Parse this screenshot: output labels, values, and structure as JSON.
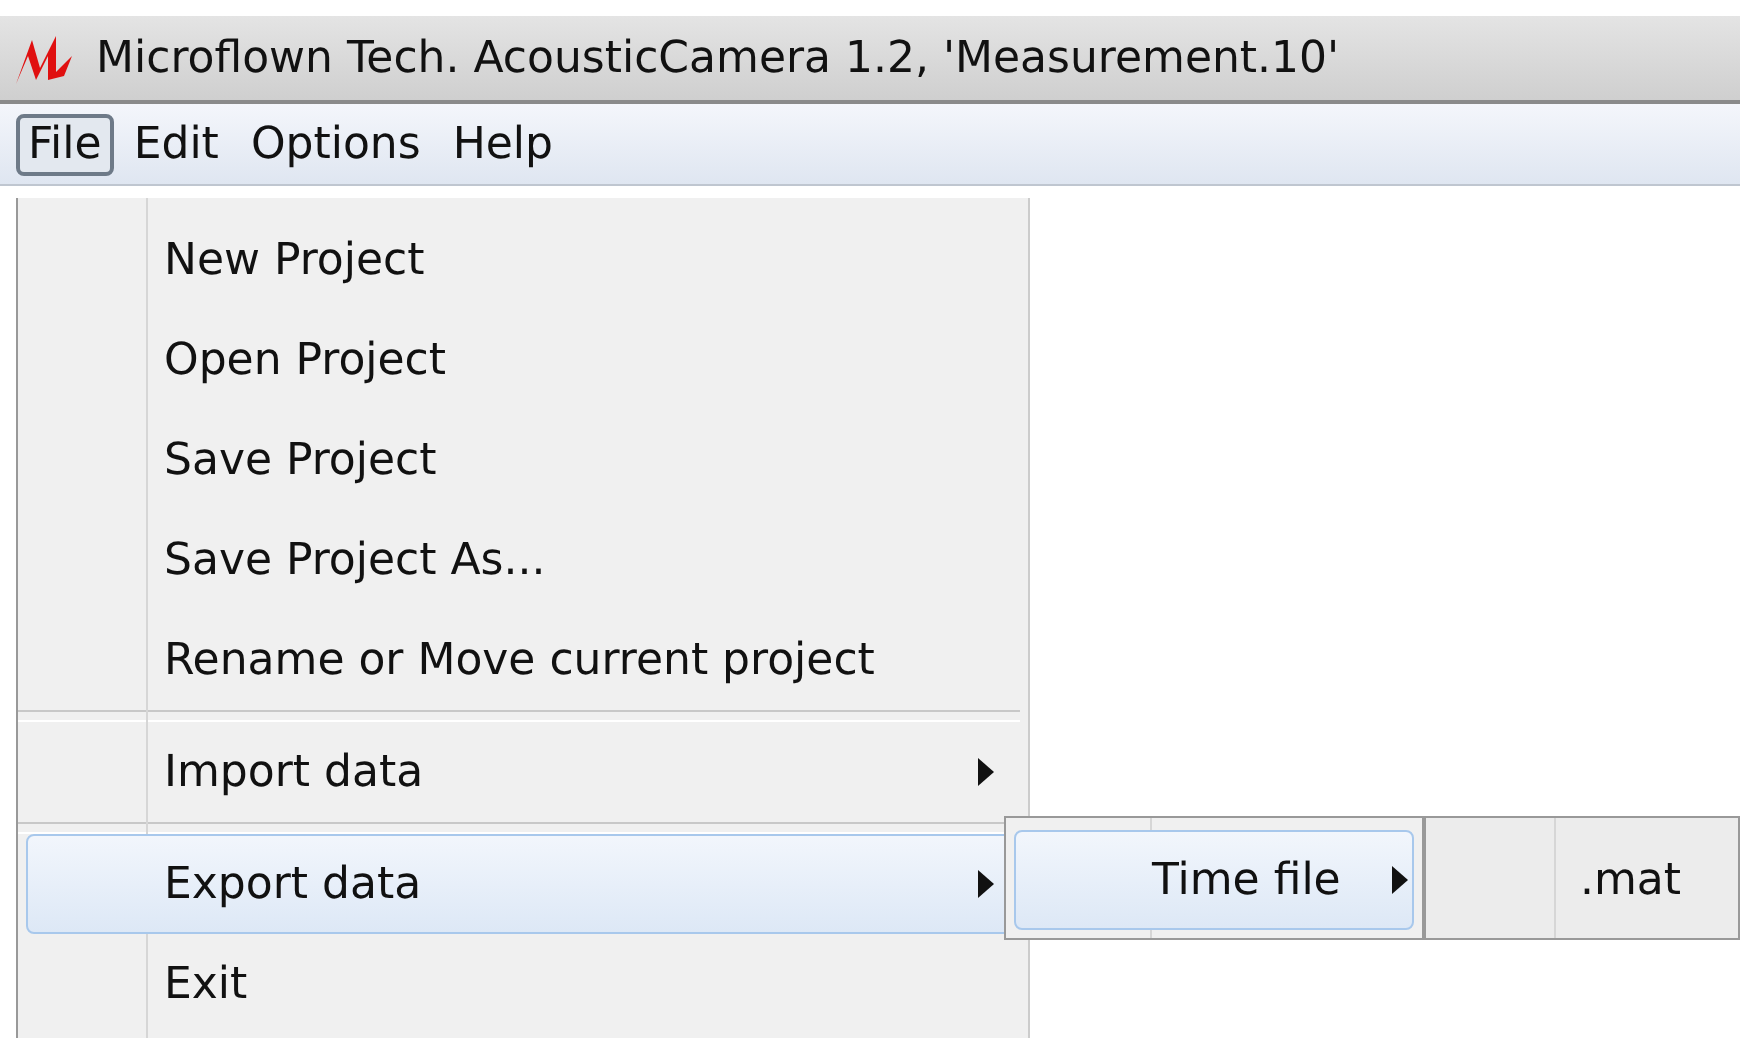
{
  "title_bar": {
    "title": "Microflown Tech. AcousticCamera 1.2, 'Measurement.10'"
  },
  "menu_bar": [
    {
      "label": "File",
      "selected": true
    },
    {
      "label": "Edit",
      "selected": false
    },
    {
      "label": "Options",
      "selected": false
    },
    {
      "label": "Help",
      "selected": false
    }
  ],
  "file_menu": {
    "items": [
      {
        "kind": "item",
        "label": "New Project",
        "selected": false,
        "has_submenu": false
      },
      {
        "kind": "item",
        "label": "Open Project",
        "selected": false,
        "has_submenu": false
      },
      {
        "kind": "item",
        "label": "Save Project",
        "selected": false,
        "has_submenu": false
      },
      {
        "kind": "item",
        "label": "Save Project As...",
        "selected": false,
        "has_submenu": false
      },
      {
        "kind": "item",
        "label": "Rename or Move current project",
        "selected": false,
        "has_submenu": false
      },
      {
        "kind": "separator"
      },
      {
        "kind": "item",
        "label": "Import data",
        "selected": false,
        "has_submenu": true
      },
      {
        "kind": "separator"
      },
      {
        "kind": "item",
        "label": "Export data",
        "selected": true,
        "has_submenu": true
      },
      {
        "kind": "item",
        "label": "Exit",
        "selected": false,
        "has_submenu": false
      }
    ]
  },
  "export_submenu": {
    "items": [
      {
        "kind": "item",
        "label": "Time file",
        "selected": true,
        "has_submenu": true
      }
    ]
  },
  "time_file_submenu": {
    "items": [
      {
        "kind": "item",
        "label": ".mat",
        "selected": false,
        "has_submenu": false
      }
    ]
  }
}
